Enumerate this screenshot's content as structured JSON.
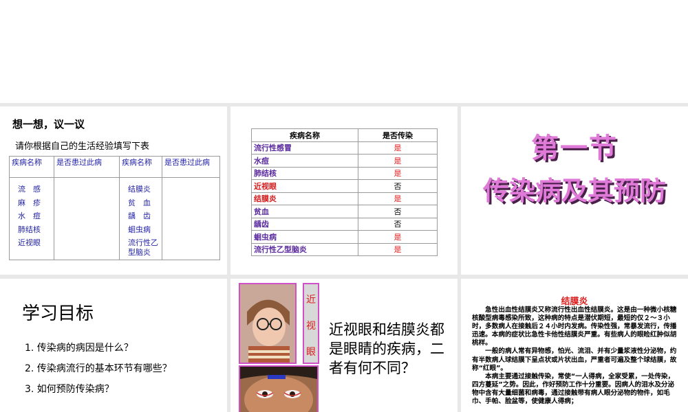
{
  "slide1": {
    "title": "想一想，议一议",
    "subtitle": "请你根据自己的生活经验填写下表",
    "headers": [
      "疾病名称",
      "是否患过此病",
      "疾病名称",
      "是否患过此病"
    ],
    "left_diseases": [
      "流　感",
      "麻　疹",
      "水　痘",
      "肺结核",
      "近视眼"
    ],
    "right_diseases": [
      "结膜炎",
      "贫　血",
      "龋　齿",
      "蛔虫病",
      "流行性乙型脑炎"
    ]
  },
  "slide2": {
    "headers": [
      "疾病名称",
      "是否传染"
    ],
    "rows": [
      {
        "name": "流行性感冒",
        "value": "是"
      },
      {
        "name": "水痘",
        "value": "是"
      },
      {
        "name": "肺结核",
        "value": "是"
      },
      {
        "name": "近视眼",
        "value": "否"
      },
      {
        "name": "结膜炎",
        "value": "是"
      },
      {
        "name": "贫血",
        "value": "否"
      },
      {
        "name": "龋齿",
        "value": "否"
      },
      {
        "name": "蛔虫病",
        "value": "是"
      },
      {
        "name": "流行性乙型脑炎",
        "value": "是"
      }
    ]
  },
  "slide3": {
    "line1": "第一节",
    "line2": "传染病及其预防"
  },
  "slide4": {
    "heading": "学习目标",
    "questions": [
      "1. 传染病的病因是什么？",
      "2. 传染病流行的基本环节有哪些？",
      "3. 如何预防传染病？"
    ]
  },
  "slide5": {
    "side_label": [
      "近",
      "视",
      "眼"
    ],
    "question": "近视眼和结膜炎都是眼睛的疾病，二者有何不同？"
  },
  "slide6": {
    "title": "结膜炎",
    "paragraphs": [
      "　　急性出血性结膜炎又称流行性出血性结膜炎。这是由一种微小核糖核酸型病毒感染所致，这种病的特点是潜伏期短，最短的仅２～３小时，多数病人在接触后２４小时内发病。传染性强，常暴发流行，传播迅速。本病的症状比急性卡他性结膜炎严重。有些病人的眼睑红肿似胡桃样。",
      "　　一般的病人常有异物感，怕光、流泪、并有少量浆液性分泌物，约有半数病人球结膜下呈点状或片状出血，严重者可遍及整个球结膜，故称“红眼”。",
      "　　本病主要通过接触传染，常使“一人得病，全家受累，一处传染，四方蔓延”之势。因此，作好预防工作十分重要。因病人的泪水及分泌物中含有大量细菌和病毒，通过接触带有病人眼分泌物的物件，如毛巾、手帕、脸盆等，使健康人得病；"
    ]
  },
  "colors": {
    "table_text": "#2323a8",
    "disease_purple": "#5a2a9e",
    "yes_red": "#e01b1b",
    "title_pink": "#e07ad8",
    "frame_magenta": "#d050c8"
  }
}
